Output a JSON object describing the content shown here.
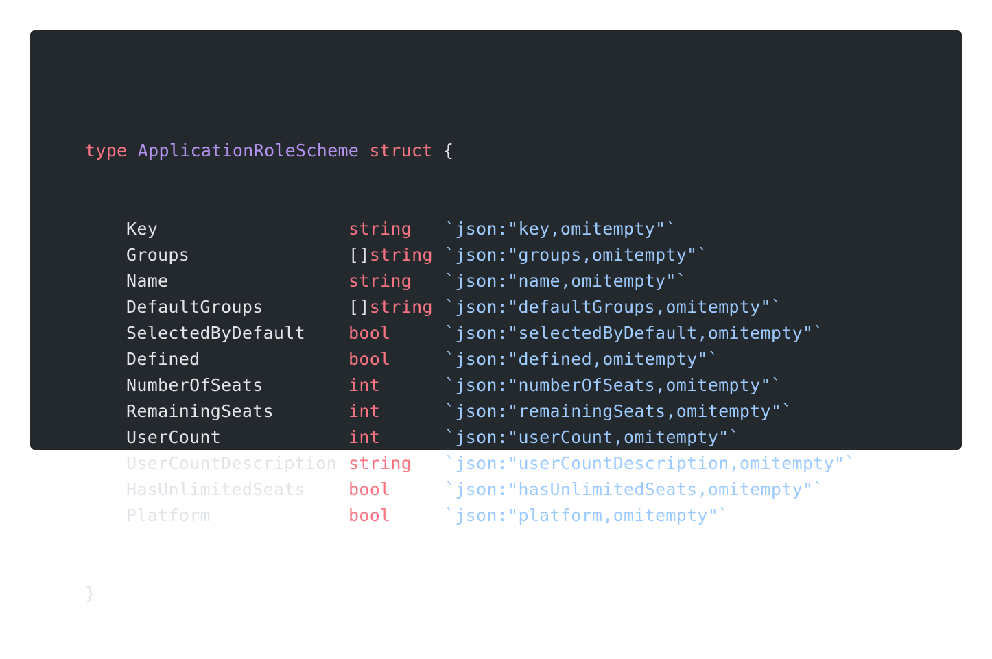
{
  "code": {
    "keyword_type": "type",
    "struct_name": "ApplicationRoleScheme",
    "keyword_struct": "struct",
    "open_brace": "{",
    "close_brace": "}",
    "fields": [
      {
        "name": "Key",
        "prefix": "",
        "type": "string",
        "tag": "`json:\"key,omitempty\"`"
      },
      {
        "name": "Groups",
        "prefix": "[]",
        "type": "string",
        "tag": "`json:\"groups,omitempty\"`"
      },
      {
        "name": "Name",
        "prefix": "",
        "type": "string",
        "tag": "`json:\"name,omitempty\"`"
      },
      {
        "name": "DefaultGroups",
        "prefix": "[]",
        "type": "string",
        "tag": "`json:\"defaultGroups,omitempty\"`"
      },
      {
        "name": "SelectedByDefault",
        "prefix": "",
        "type": "bool",
        "tag": "`json:\"selectedByDefault,omitempty\"`"
      },
      {
        "name": "Defined",
        "prefix": "",
        "type": "bool",
        "tag": "`json:\"defined,omitempty\"`"
      },
      {
        "name": "NumberOfSeats",
        "prefix": "",
        "type": "int",
        "tag": "`json:\"numberOfSeats,omitempty\"`"
      },
      {
        "name": "RemainingSeats",
        "prefix": "",
        "type": "int",
        "tag": "`json:\"remainingSeats,omitempty\"`"
      },
      {
        "name": "UserCount",
        "prefix": "",
        "type": "int",
        "tag": "`json:\"userCount,omitempty\"`"
      },
      {
        "name": "UserCountDescription",
        "prefix": "",
        "type": "string",
        "tag": "`json:\"userCountDescription,omitempty\"`"
      },
      {
        "name": "HasUnlimitedSeats",
        "prefix": "",
        "type": "bool",
        "tag": "`json:\"hasUnlimitedSeats,omitempty\"`"
      },
      {
        "name": "Platform",
        "prefix": "",
        "type": "bool",
        "tag": "`json:\"platform,omitempty\"`"
      }
    ]
  },
  "colors": {
    "background": "#24292e",
    "keyword": "#f97583",
    "type_name": "#b392f0",
    "identifier": "#e1e4e8",
    "string_tag": "#9ecbff"
  }
}
